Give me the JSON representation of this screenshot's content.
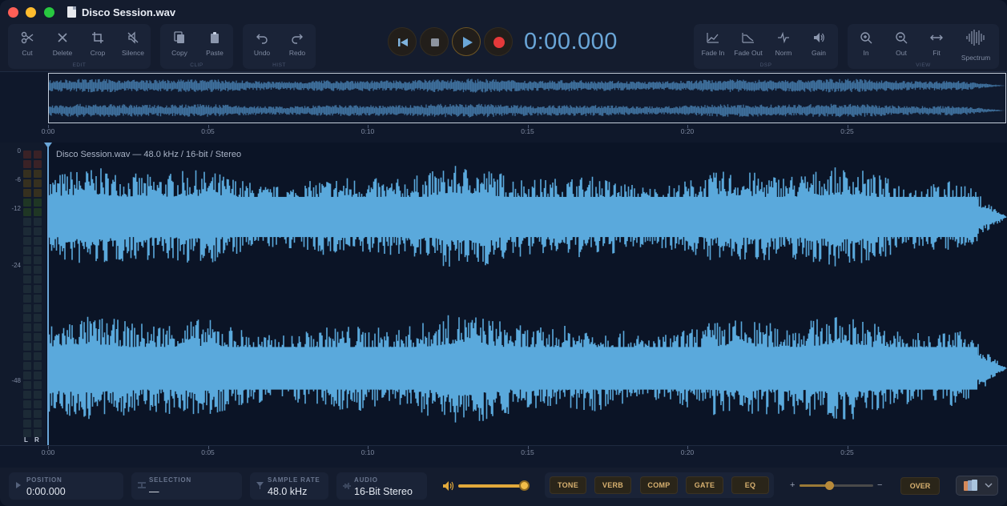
{
  "window": {
    "title": "Disco Session.wav"
  },
  "toolbar": {
    "edit": {
      "label": "EDIT",
      "cut": "Cut",
      "delete": "Delete",
      "crop": "Crop",
      "silence": "Silence"
    },
    "clip": {
      "label": "CLIP",
      "copy": "Copy",
      "paste": "Paste"
    },
    "hist": {
      "label": "HIST",
      "undo": "Undo",
      "redo": "Redo"
    },
    "dsp": {
      "label": "DSP",
      "fade_in": "Fade In",
      "fade_out": "Fade Out",
      "norm": "Norm",
      "gain": "Gain"
    },
    "view": {
      "label": "VIEW",
      "zoom_in": "In",
      "zoom_out": "Out",
      "fit": "Fit",
      "spectrum": "Spectrum"
    }
  },
  "transport": {
    "time": "0:00.000",
    "accent": "#6aa6d8",
    "record_color": "#e5393a"
  },
  "timeline": {
    "ticks": [
      "0:00",
      "0:05",
      "0:10",
      "0:15",
      "0:20",
      "0:25"
    ]
  },
  "editor": {
    "file_info": "Disco Session.wav — 48.0 kHz / 16-bit / Stereo",
    "db_labels": [
      "0",
      "-6",
      "-12",
      "-24",
      "-48"
    ],
    "meter_channels": [
      "L",
      "R"
    ],
    "waveform_color": "#5aa9dc"
  },
  "status": {
    "position": {
      "caption": "POSITION",
      "value": "0:00.000"
    },
    "selection": {
      "caption": "SELECTION",
      "value": "—"
    },
    "sample_rate": {
      "caption": "SAMPLE RATE",
      "value": "48.0 kHz"
    },
    "audio": {
      "caption": "AUDIO",
      "value": "16-Bit Stereo"
    },
    "volume_level": 1.0,
    "effects": [
      "TONE",
      "VERB",
      "COMP",
      "GATE",
      "EQ"
    ],
    "zoom_plus": "+",
    "zoom_minus": "−",
    "zoom_level": 0.4,
    "over": "OVER"
  }
}
